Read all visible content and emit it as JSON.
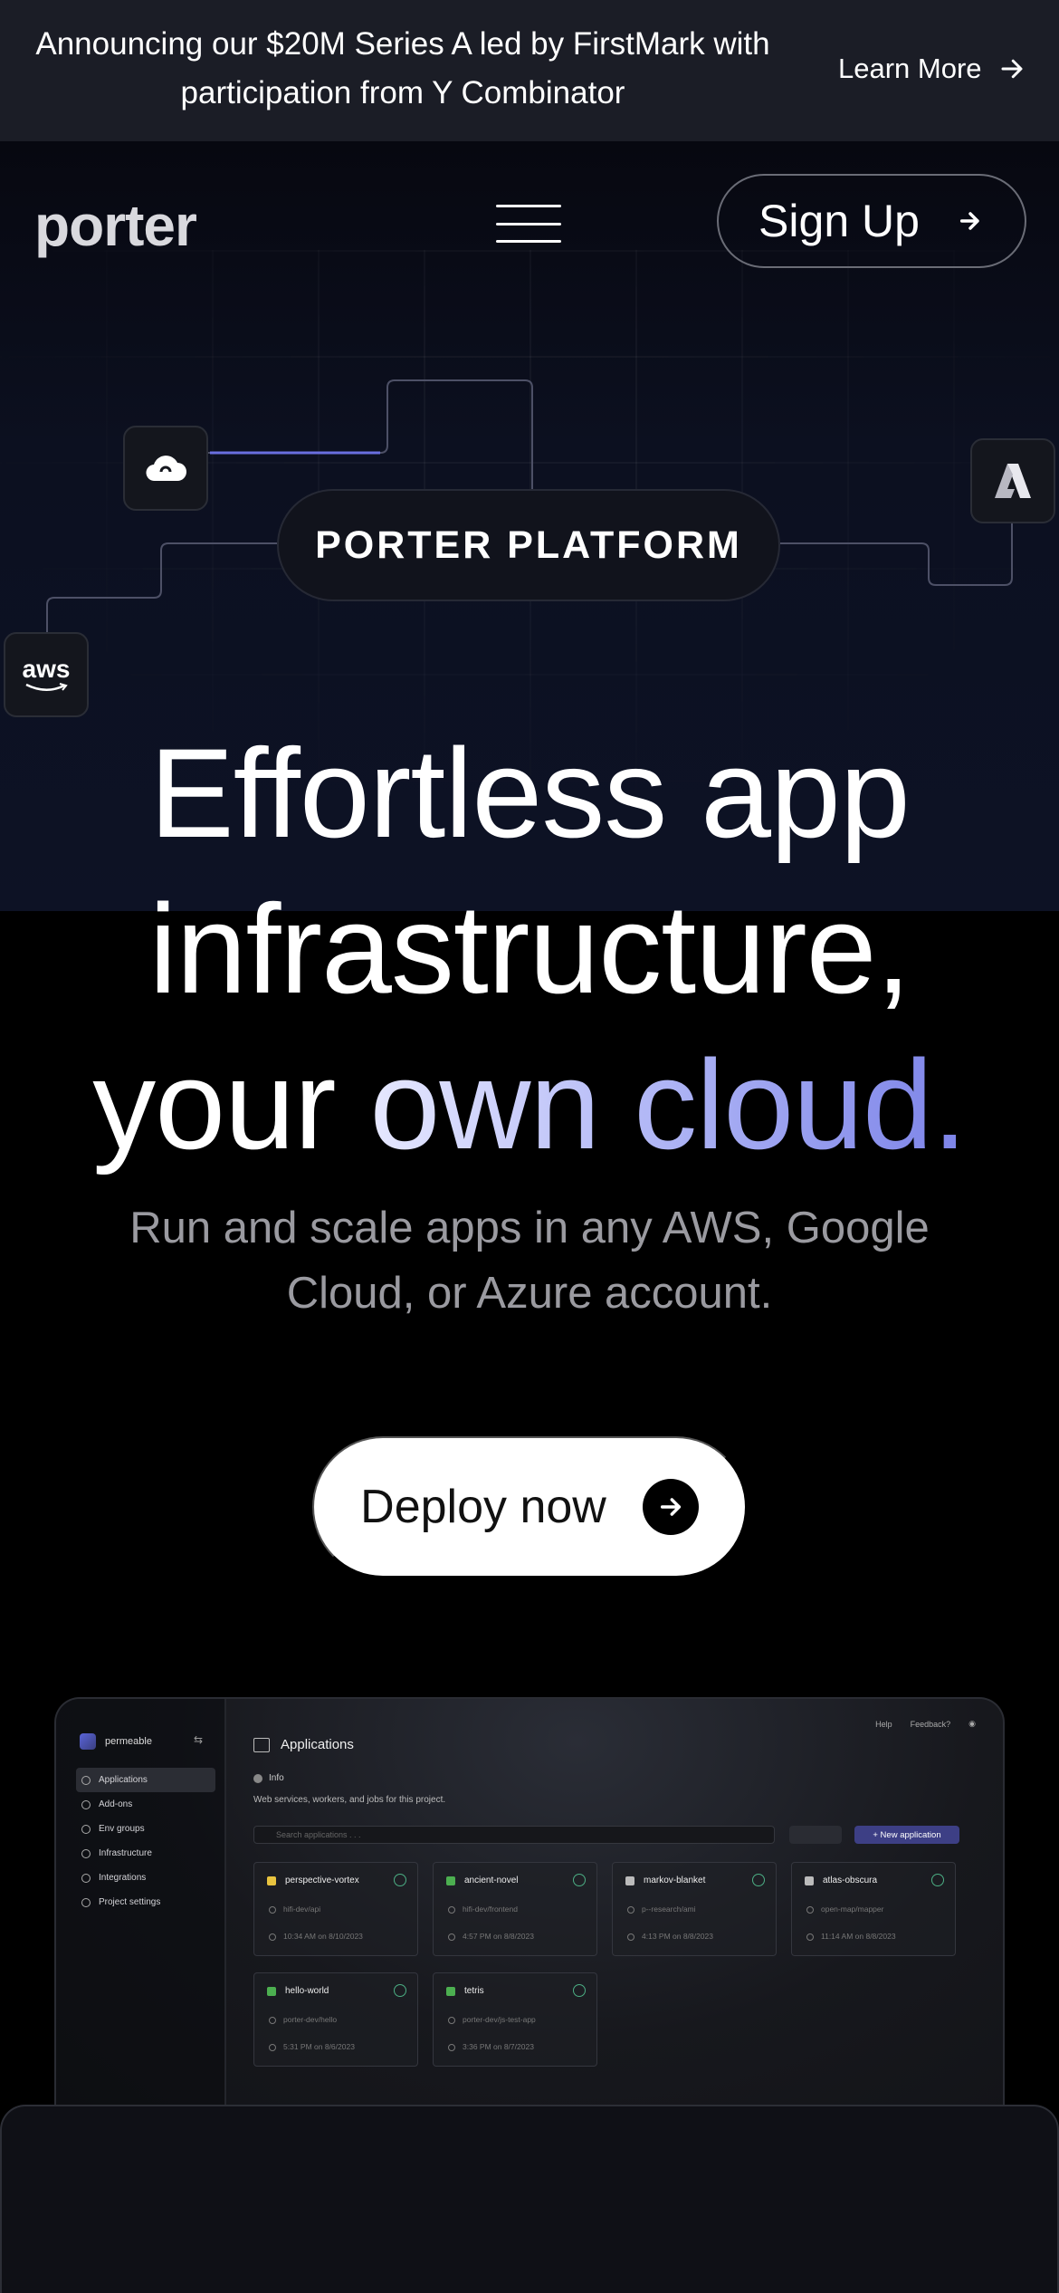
{
  "announcement": {
    "text": "Announcing our $20M Series A led by FirstMark with participation from Y Combinator",
    "link_label": "Learn More"
  },
  "nav": {
    "logo": "porter",
    "signup_label": "Sign Up"
  },
  "diagram": {
    "platform_label": "PORTER PLATFORM",
    "aws_label": "aws"
  },
  "hero": {
    "line1": "Effortless app",
    "line2": "infrastructure,",
    "line3_plain": "your ",
    "line3_grad": "own cloud.",
    "subtitle": "Run and scale apps in any AWS, Google Cloud, or Azure account.",
    "cta_label": "Deploy now"
  },
  "dashboard": {
    "project_name": "permeable",
    "sidebar": [
      "Applications",
      "Add-ons",
      "Env groups",
      "Infrastructure",
      "Integrations",
      "Project settings"
    ],
    "title": "Applications",
    "help": "Help",
    "feedback": "Feedback?",
    "info_label": "Info",
    "info_desc": "Web services, workers, and jobs for this project.",
    "search_placeholder": "Search applications . . .",
    "new_app_label": "+ New application",
    "apps": [
      {
        "name": "perspective-vortex",
        "repo": "hifi-dev/api",
        "time": "10:34 AM on 8/10/2023",
        "color": "#e8c33f"
      },
      {
        "name": "ancient-novel",
        "repo": "hifi-dev/frontend",
        "time": "4:57 PM on 8/8/2023",
        "color": "#4caf50"
      },
      {
        "name": "markov-blanket",
        "repo": "p--research/ami",
        "time": "4:13 PM on 8/8/2023",
        "color": "#bbbbbb"
      },
      {
        "name": "atlas-obscura",
        "repo": "open-map/mapper",
        "time": "11:14 AM on 8/8/2023",
        "color": "#bbbbbb"
      },
      {
        "name": "hello-world",
        "repo": "porter-dev/hello",
        "time": "5:31 PM on 8/6/2023",
        "color": "#4caf50"
      },
      {
        "name": "tetris",
        "repo": "porter-dev/js-test-app",
        "time": "3:36 PM on 8/7/2023",
        "color": "#4caf50"
      }
    ]
  },
  "colors": {
    "accent": "#7c83e8",
    "announce_bg": "#1b1d26"
  }
}
